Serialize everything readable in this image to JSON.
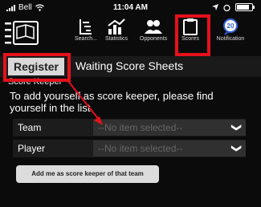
{
  "status_bar": {
    "carrier": "Bell",
    "time": "11:04 AM"
  },
  "nav": {
    "items": [
      {
        "label": "Search...",
        "icon": "search-icon"
      },
      {
        "label": "Statistics",
        "icon": "statistics-icon"
      },
      {
        "label": "Opponents",
        "icon": "opponents-icon"
      },
      {
        "label": "Scores",
        "icon": "clipboard-icon"
      },
      {
        "label": "Notification",
        "icon": "notification-icon",
        "badge": "20"
      }
    ]
  },
  "tabs": {
    "register": "Register",
    "waiting": "Waiting Score Sheets"
  },
  "content": {
    "section_title": "Score Keeper",
    "instructions": "To add yourself as score keeper, please find yourself in the list.",
    "team_label": "Team",
    "player_label": "Player",
    "team_placeholder": "--No item selected--",
    "player_placeholder": "--No item selected--",
    "add_button": "Add me as score keeper of that team"
  },
  "colors": {
    "highlight": "#e4111b",
    "background": "#0b0b0b"
  }
}
